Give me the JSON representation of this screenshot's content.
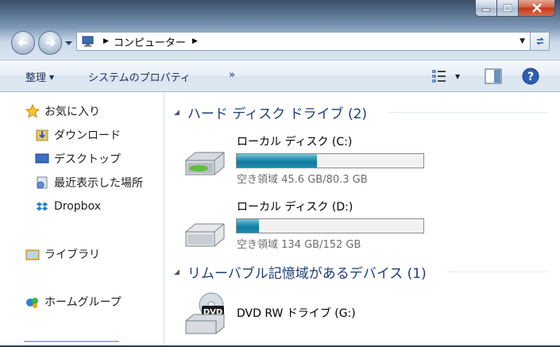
{
  "window": {
    "title_bar_icons": [
      "minimize-icon",
      "maximize-icon",
      "close-icon"
    ]
  },
  "address": {
    "path_label": "コンピューター",
    "icons": [
      "back-icon",
      "forward-icon",
      "computer-icon",
      "refresh-icon"
    ]
  },
  "toolbar": {
    "organize": "整理",
    "system_properties": "システムのプロパティ",
    "more": "»"
  },
  "nav": {
    "favorites": "お気に入り",
    "downloads": "ダウンロード",
    "desktop": "デスクトップ",
    "recent": "最近表示した場所",
    "dropbox": "Dropbox",
    "libraries": "ライブラリ",
    "homegroup": "ホームグループ"
  },
  "groups": {
    "hdd": "ハード ディスク ドライブ (2)",
    "removable": "リムーバブル記憶域があるデバイス (1)"
  },
  "drives": [
    {
      "name": "ローカル ディスク (C:)",
      "free_text": "空き領域 45.6 GB/80.3 GB",
      "used_fraction": 0.43
    },
    {
      "name": "ローカル ディスク (D:)",
      "free_text": "空き領域 134 GB/152 GB",
      "used_fraction": 0.12
    }
  ],
  "dvd": {
    "name": "DVD RW ドライブ (G:)",
    "icon_label": "DVD"
  },
  "colors": {
    "accent": "#1f3d7a",
    "bar_fill": "#1d8cb2",
    "close_button": "#c2361a"
  }
}
